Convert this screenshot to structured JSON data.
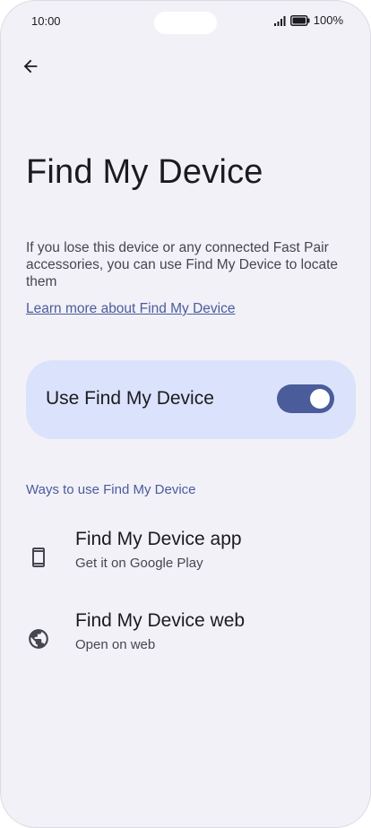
{
  "status_bar": {
    "time": "10:00",
    "battery_percent": "100%",
    "icons": [
      "signal-icon",
      "battery-icon"
    ]
  },
  "header": {
    "back_icon": "arrow-back-icon"
  },
  "page": {
    "title": "Find My Device",
    "description": "If you lose this device or any connected Fast Pair accessories, you can use Find My Device to locate them",
    "learn_more": "Learn more about Find My Device"
  },
  "toggle": {
    "label": "Use Find My Device",
    "enabled": true
  },
  "ways": {
    "header": "Ways to use Find My Device",
    "items": [
      {
        "icon": "smartphone-icon",
        "title": "Find My Device app",
        "subtitle": "Get it on Google Play"
      },
      {
        "icon": "globe-icon",
        "title": "Find My Device web",
        "subtitle": "Open on web"
      }
    ]
  },
  "colors": {
    "background": "#f2f1f8",
    "accent": "#4a5c9a",
    "card": "#dbe2fb",
    "text": "#1b1b1f"
  }
}
